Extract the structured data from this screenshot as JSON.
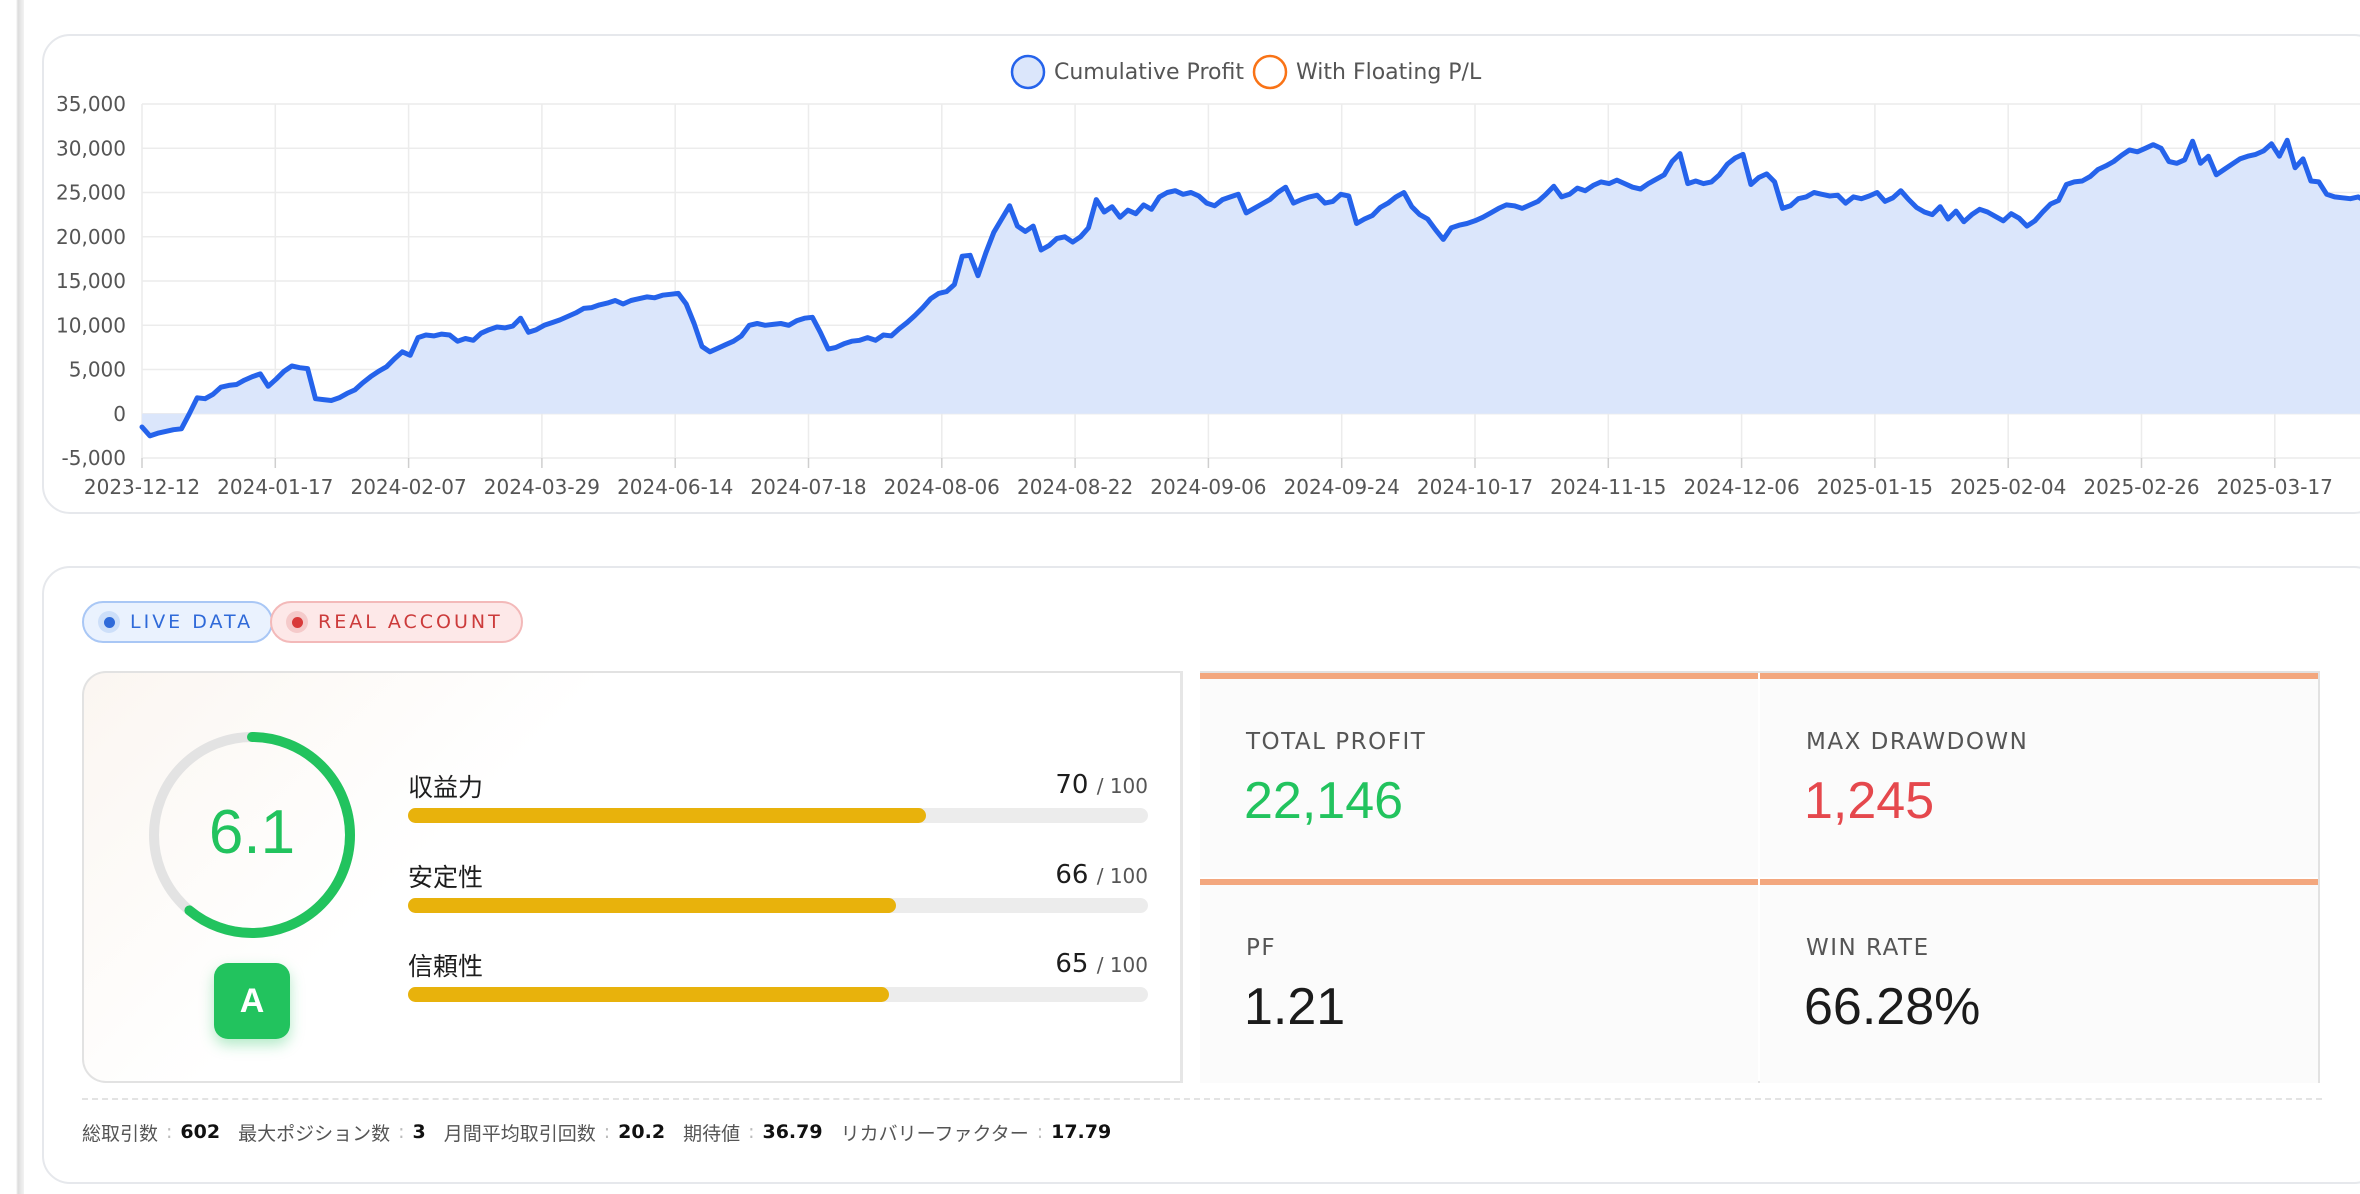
{
  "chart_data": {
    "type": "area",
    "legend": [
      {
        "name": "Cumulative Profit",
        "color": "#2563eb",
        "fill": "#dbe6fb"
      },
      {
        "name": "With Floating P/L",
        "color": "#f97316",
        "fill": "#ffffff"
      }
    ],
    "legend_position": "top-center",
    "ylim": [
      -5000,
      35000
    ],
    "yticks": [
      35000,
      30000,
      25000,
      20000,
      15000,
      10000,
      5000,
      0,
      -5000
    ],
    "ytick_labels": [
      "35,000",
      "30,000",
      "25,000",
      "20,000",
      "15,000",
      "10,000",
      "5,000",
      "0",
      "-5,000"
    ],
    "xtick_labels": [
      "2023-12-12",
      "2024-01-17",
      "2024-02-07",
      "2024-03-29",
      "2024-06-14",
      "2024-07-18",
      "2024-08-06",
      "2024-08-22",
      "2024-09-06",
      "2024-09-24",
      "2024-10-17",
      "2024-11-15",
      "2024-12-06",
      "2025-01-15",
      "2025-02-04",
      "2025-02-26",
      "2025-03-17"
    ],
    "grid": true,
    "series": [
      {
        "name": "Cumulative Profit",
        "values": [
          -1500,
          -2500,
          -2200,
          -2000,
          -1800,
          -1700,
          0,
          1800,
          1700,
          2200,
          3000,
          3200,
          3300,
          3800,
          4200,
          4500,
          3100,
          3900,
          4800,
          5400,
          5200,
          5100,
          1700,
          1600,
          1500,
          1800,
          2300,
          2700,
          3500,
          4200,
          4800,
          5300,
          6200,
          7000,
          6600,
          8600,
          8900,
          8800,
          9000,
          8900,
          8200,
          8500,
          8300,
          9100,
          9500,
          9800,
          9700,
          9900,
          10800,
          9200,
          9500,
          10000,
          10300,
          10600,
          11000,
          11400,
          11900,
          12000,
          12300,
          12500,
          12800,
          12400,
          12800,
          13000,
          13200,
          13100,
          13400,
          13500,
          13600,
          12400,
          10200,
          7600,
          7000,
          7400,
          7800,
          8200,
          8800,
          10000,
          10200,
          10000,
          10100,
          10200,
          10000,
          10500,
          10800,
          10900,
          9200,
          7300,
          7500,
          7900,
          8200,
          8300,
          8600,
          8300,
          8900,
          8800,
          9600,
          10300,
          11100,
          12000,
          13000,
          13600,
          13800,
          14600,
          17800,
          17900,
          15600,
          18200,
          20500,
          22000,
          23500,
          21200,
          20600,
          21200,
          18500,
          19000,
          19800,
          20000,
          19400,
          20000,
          21000,
          24200,
          22800,
          23400,
          22200,
          23000,
          22600,
          23600,
          23100,
          24500,
          25000,
          25200,
          24800,
          25000,
          24600,
          23800,
          23500,
          24200,
          24500,
          24800,
          22700,
          23200,
          23700,
          24200,
          25000,
          25600,
          23800,
          24200,
          24500,
          24700,
          23800,
          24000,
          24800,
          24600,
          21500,
          22000,
          22400,
          23300,
          23800,
          24500,
          25000,
          23400,
          22500,
          22000,
          20800,
          19700,
          21000,
          21300,
          21500,
          21800,
          22200,
          22700,
          23200,
          23600,
          23500,
          23200,
          23600,
          24000,
          24800,
          25700,
          24500,
          24800,
          25500,
          25200,
          25800,
          26200,
          26000,
          26400,
          26000,
          25600,
          25400,
          26000,
          26500,
          27000,
          28500,
          29400,
          26000,
          26300,
          26000,
          26200,
          27000,
          28200,
          28900,
          29300,
          25900,
          26700,
          27100,
          26200,
          23200,
          23500,
          24300,
          24500,
          25000,
          24800,
          24600,
          24700,
          23800,
          24500,
          24300,
          24600,
          25000,
          24000,
          24400,
          25200,
          24200,
          23300,
          22800,
          22500,
          23400,
          22000,
          22900,
          21700,
          22500,
          23100,
          22800,
          22300,
          21800,
          22600,
          22100,
          21200,
          21800,
          22800,
          23700,
          24100,
          25900,
          26200,
          26300,
          26800,
          27600,
          28000,
          28500,
          29200,
          29800,
          29600,
          30000,
          30400,
          30000,
          28500,
          28300,
          28700,
          30800,
          28300,
          29100,
          27000,
          27600,
          28200,
          28800,
          29100,
          29300,
          29700,
          30500,
          29100,
          30900,
          27800,
          28800,
          26300,
          26200,
          24800,
          24500,
          24400,
          24300,
          24500,
          24000,
          22300
        ]
      },
      {
        "name": "With Floating P/L",
        "values": []
      }
    ]
  },
  "badges": {
    "live": "LIVE DATA",
    "real": "REAL ACCOUNT"
  },
  "score": {
    "value": "6.1",
    "max_value": 10,
    "grade": "A",
    "color": "#22c35e",
    "track_color": "#e3e3e3"
  },
  "metrics": [
    {
      "label": "収益力",
      "score": "70",
      "max": "/ 100",
      "fraction": 0.7
    },
    {
      "label": "安定性",
      "score": "66",
      "max": "/ 100",
      "fraction": 0.66
    },
    {
      "label": "信頼性",
      "score": "65",
      "max": "/ 100",
      "fraction": 0.65
    }
  ],
  "stats": {
    "total_profit": {
      "label": "TOTAL PROFIT",
      "value": "22,146",
      "color": "#22c35e"
    },
    "max_drawdown": {
      "label": "MAX DRAWDOWN",
      "value": "1,245",
      "color": "#e5484d"
    },
    "pf": {
      "label": "PF",
      "value": "1.21",
      "color": "#1b1b1b"
    },
    "win_rate": {
      "label": "WIN RATE",
      "value": "66.28%",
      "color": "#1b1b1b"
    }
  },
  "footer": [
    {
      "label": "総取引数",
      "value": "602"
    },
    {
      "label": "最大ポジション数",
      "value": "3"
    },
    {
      "label": "月間平均取引回数",
      "value": "20.2"
    },
    {
      "label": "期待値",
      "value": "36.79"
    },
    {
      "label": "リカバリーファクター",
      "value": "17.79"
    }
  ],
  "colors": {
    "accent_blue": "#2563eb",
    "area_fill": "#dbe6fb",
    "grid": "#ececec",
    "stat_top_bar": "#f3a77e",
    "metric_bar": "#e8b20c"
  }
}
